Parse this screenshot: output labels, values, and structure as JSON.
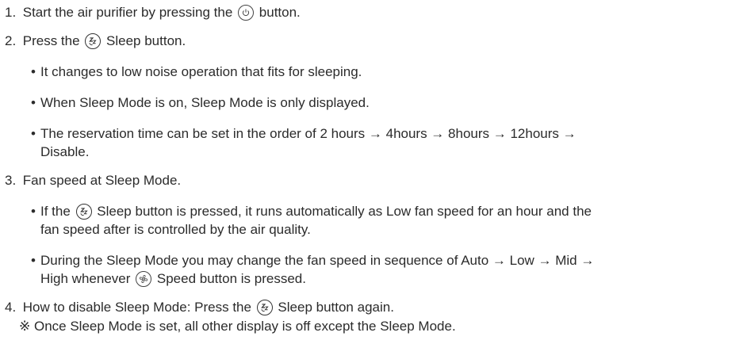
{
  "steps": [
    {
      "number": "1.",
      "before": "Start the air purifier by pressing the",
      "after": "button."
    },
    {
      "number": "2.",
      "before": "Press the",
      "after": "Sleep button.",
      "bullets": [
        "It changes to low noise operation that fits for sleeping.",
        "When Sleep Mode is on, Sleep Mode is only displayed.",
        "The reservation time can be set in the order of 2 hours → 4hours → 8hours → 12hours →",
        "Disable."
      ]
    },
    {
      "number": "3.",
      "text": "Fan speed at Sleep Mode.",
      "bullets": [
        {
          "before": "If the",
          "after": "Sleep button is pressed, it runs automatically as Low fan speed for an hour and the"
        },
        "fan speed after is controlled by the air quality.",
        "During the Sleep Mode you may change the fan speed in sequence of Auto → Low → Mid →",
        {
          "before": "High whenever",
          "after": "Speed button is pressed."
        }
      ]
    },
    {
      "number": "4.",
      "before": "How to disable  Sleep Mode: Press the",
      "after": "Sleep button again."
    }
  ],
  "note": "※ Once Sleep Mode is set, all other display is off except the Sleep Mode.",
  "icons": {
    "power": "power-icon",
    "sleep": "sleep-icon",
    "speed": "fan-speed-icon"
  },
  "bullet_char": "•"
}
